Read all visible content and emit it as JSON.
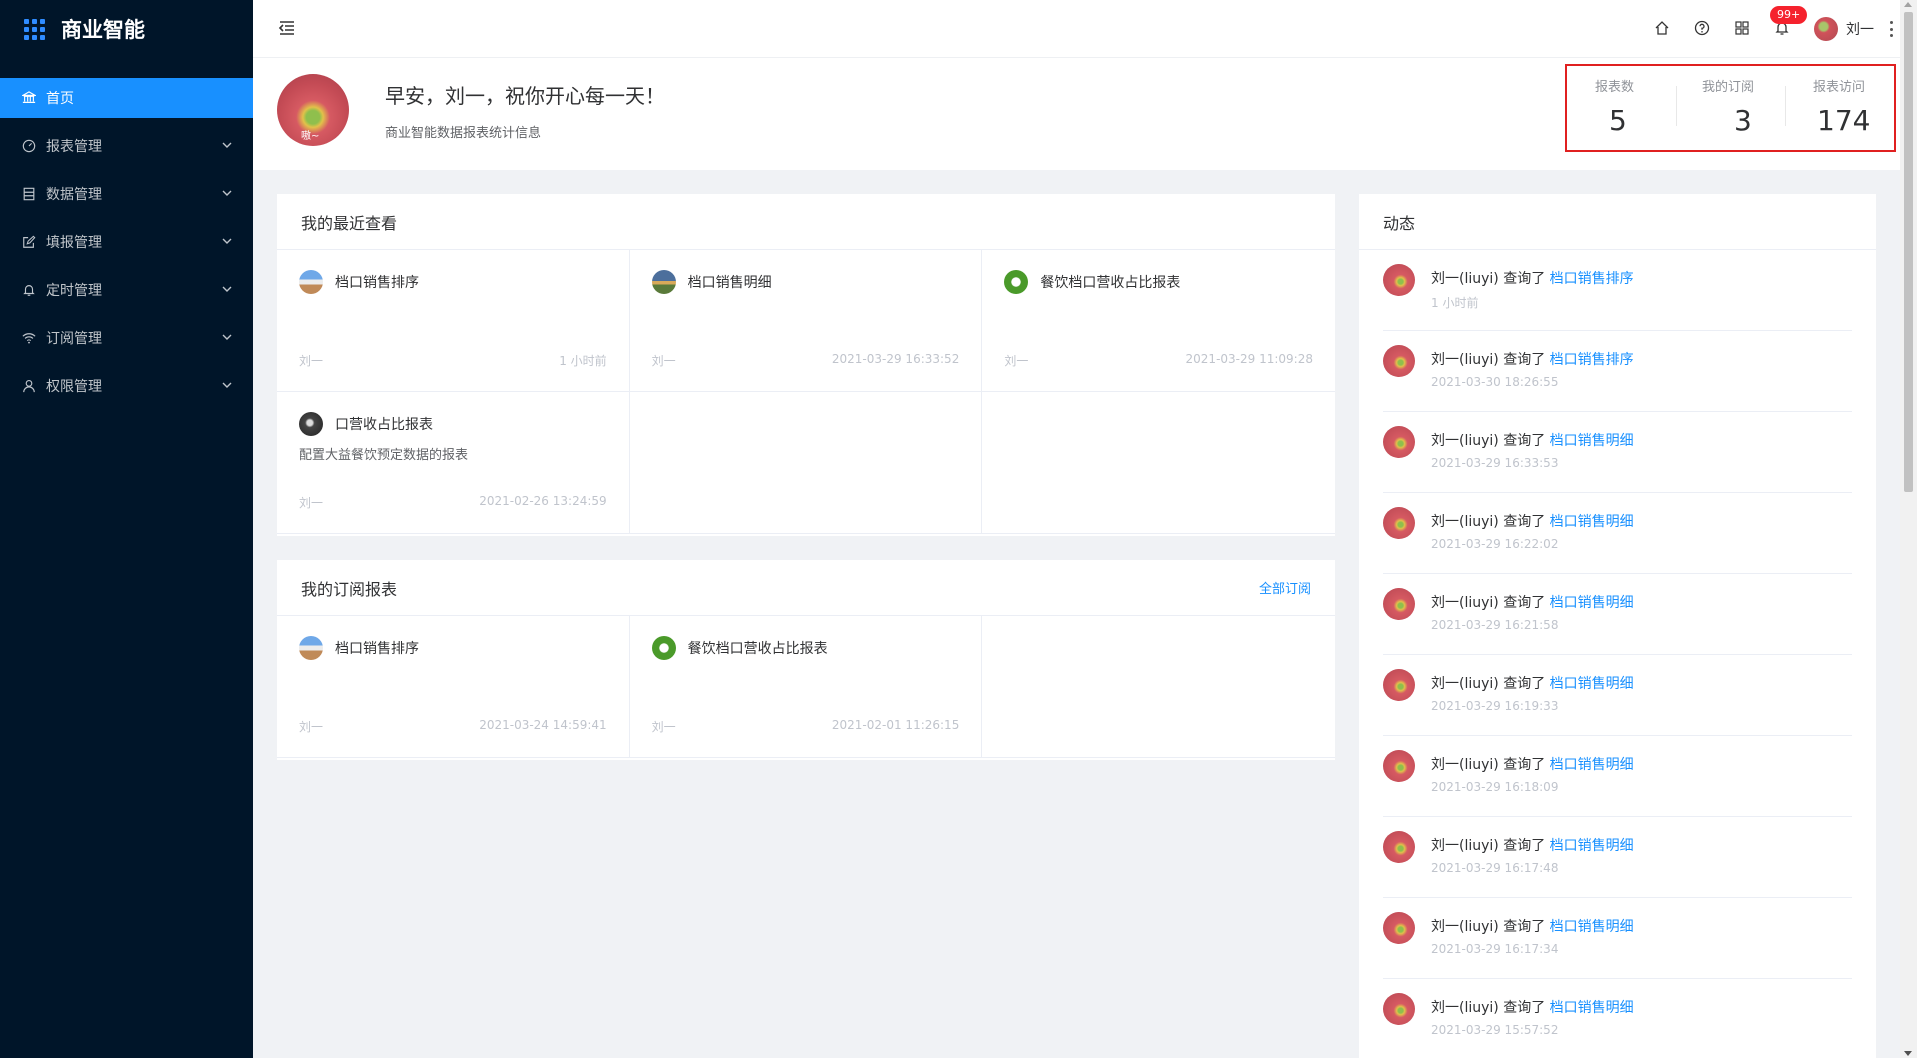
{
  "app": {
    "title": "商业智能"
  },
  "sidebar": {
    "items": [
      {
        "label": "首页",
        "icon": "bank-icon",
        "active": true
      },
      {
        "label": "报表管理",
        "icon": "dashboard-icon"
      },
      {
        "label": "数据管理",
        "icon": "database-icon"
      },
      {
        "label": "填报管理",
        "icon": "edit-icon"
      },
      {
        "label": "定时管理",
        "icon": "bell-icon"
      },
      {
        "label": "订阅管理",
        "icon": "wifi-icon"
      },
      {
        "label": "权限管理",
        "icon": "user-icon"
      }
    ]
  },
  "header": {
    "badge": "99+",
    "username": "刘一"
  },
  "welcome": {
    "avatar_text": "嗷~",
    "greeting": "早安，刘一，祝你开心每一天！",
    "subtitle": "商业智能数据报表统计信息"
  },
  "stats": [
    {
      "label": "报表数",
      "value": "5"
    },
    {
      "label": "我的订阅",
      "value": "3"
    },
    {
      "label": "报表访问",
      "value": "174"
    }
  ],
  "recent": {
    "title": "我的最近查看",
    "items": [
      {
        "icon": "road-icon",
        "title": "档口销售排序",
        "desc": "",
        "author": "刘一",
        "time": "1 小时前"
      },
      {
        "icon": "sunset-icon",
        "title": "档口销售明细",
        "desc": "",
        "author": "刘一",
        "time": "2021-03-29 16:33:52"
      },
      {
        "icon": "leaf-icon",
        "title": "餐饮档口营收占比报表",
        "desc": "",
        "author": "刘一",
        "time": "2021-03-29 11:09:28"
      },
      {
        "icon": "dark-icon",
        "title": "口营收占比报表",
        "desc": "配置大益餐饮预定数据的报表",
        "author": "刘一",
        "time": "2021-02-26 13:24:59"
      }
    ]
  },
  "subscribed": {
    "title": "我的订阅报表",
    "link": "全部订阅",
    "items": [
      {
        "icon": "road-icon",
        "title": "档口销售排序",
        "author": "刘一",
        "time": "2021-03-24 14:59:41"
      },
      {
        "icon": "leaf-icon",
        "title": "餐饮档口营收占比报表",
        "author": "刘一",
        "time": "2021-02-01 11:26:15"
      }
    ]
  },
  "feed": {
    "title": "动态",
    "verb": "查询了",
    "items": [
      {
        "user": "刘一(liuyi)",
        "report": "档口销售排序",
        "time": "1 小时前"
      },
      {
        "user": "刘一(liuyi)",
        "report": "档口销售排序",
        "time": "2021-03-30 18:26:55"
      },
      {
        "user": "刘一(liuyi)",
        "report": "档口销售明细",
        "time": "2021-03-29 16:33:53"
      },
      {
        "user": "刘一(liuyi)",
        "report": "档口销售明细",
        "time": "2021-03-29 16:22:02"
      },
      {
        "user": "刘一(liuyi)",
        "report": "档口销售明细",
        "time": "2021-03-29 16:21:58"
      },
      {
        "user": "刘一(liuyi)",
        "report": "档口销售明细",
        "time": "2021-03-29 16:19:33"
      },
      {
        "user": "刘一(liuyi)",
        "report": "档口销售明细",
        "time": "2021-03-29 16:18:09"
      },
      {
        "user": "刘一(liuyi)",
        "report": "档口销售明细",
        "time": "2021-03-29 16:17:48"
      },
      {
        "user": "刘一(liuyi)",
        "report": "档口销售明细",
        "time": "2021-03-29 16:17:34"
      },
      {
        "user": "刘一(liuyi)",
        "report": "档口销售明细",
        "time": "2021-03-29 15:57:52"
      }
    ]
  }
}
